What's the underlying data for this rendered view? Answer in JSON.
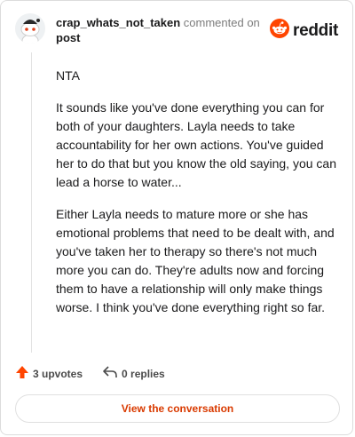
{
  "comment": {
    "username": "crap_whats_not_taken",
    "action_text": "commented on",
    "post_link": "post",
    "paragraphs": [
      "NTA",
      "It sounds like you've done everything you can for both of your daughters. Layla needs to take accountability for her own actions. You've guided her to do that but you know the old saying, you can lead a horse to water...",
      "Either Layla needs to mature more or she has emotional problems that need to be dealt with, and you've taken her to therapy so there's not much more you can do. They're adults now and forcing them to have a relationship will only make things worse. I think you've done everything right so far."
    ],
    "upvotes_label": "3 upvotes",
    "replies_label": "0 replies"
  },
  "brand": {
    "name": "reddit",
    "accent": "#ff4500"
  },
  "footer": {
    "view_button_label": "View the conversation"
  },
  "icons": {
    "avatar": "snoo-avatar-icon",
    "logo": "reddit-logo-icon",
    "upvote": "upvote-arrow-icon",
    "reply": "reply-arrow-icon"
  }
}
